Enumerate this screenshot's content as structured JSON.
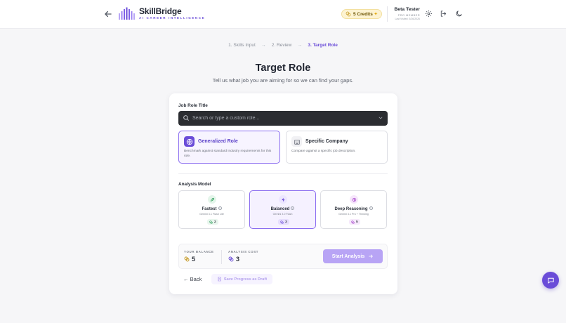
{
  "header": {
    "brand": "SkillBridge",
    "tagline": "AI CAREER INTELLIGENCE",
    "credits_label": "5 Credits",
    "user_name": "Beta Tester",
    "user_role": "PRO MEMBER",
    "user_last_visited": "Last Visited: 3/26/2026"
  },
  "stepper": {
    "steps": [
      "1. Skills Input",
      "2. Review",
      "3. Target Role"
    ],
    "active_index": 2
  },
  "page": {
    "title": "Target Role",
    "subtitle": "Tell us what job you are aiming for so we can find your gaps."
  },
  "job_role": {
    "label": "Job Role Title",
    "placeholder": "Search or type a custom role..."
  },
  "role_options": [
    {
      "title": "Generalized Role",
      "description": "Benchmark against standard industry requirements for this role.",
      "selected": true,
      "icon": "globe-icon"
    },
    {
      "title": "Specific Company",
      "description": "Compare against a specific job description.",
      "selected": false,
      "icon": "building-icon"
    }
  ],
  "analysis_model": {
    "label": "Analysis Model",
    "models": [
      {
        "name": "Fastest",
        "subtitle": "Gemini 3.1 Flash Lite",
        "cost": "2",
        "selected": false,
        "icon": "rocket-icon",
        "color": "#2e9d5a"
      },
      {
        "name": "Balanced",
        "subtitle": "Gemini 3.0 Flash",
        "cost": "3",
        "selected": true,
        "icon": "bolt-icon",
        "color": "#6a4cd8"
      },
      {
        "name": "Deep Reasoning",
        "subtitle": "Gemini 3.1 Pro + Thinking",
        "cost": "5",
        "selected": false,
        "icon": "brain-icon",
        "color": "#a13cc9"
      }
    ]
  },
  "summary": {
    "balance_label": "YOUR BALANCE",
    "balance_value": "5",
    "cost_label": "ANALYSIS COST",
    "cost_value": "3",
    "start_label": "Start Analysis"
  },
  "footer": {
    "back_label": "← Back",
    "draft_label": "Save Progress as Draft"
  },
  "colors": {
    "accent": "#6a4cd8",
    "accent_light": "#b8a4f5",
    "coin": "#c29417"
  }
}
